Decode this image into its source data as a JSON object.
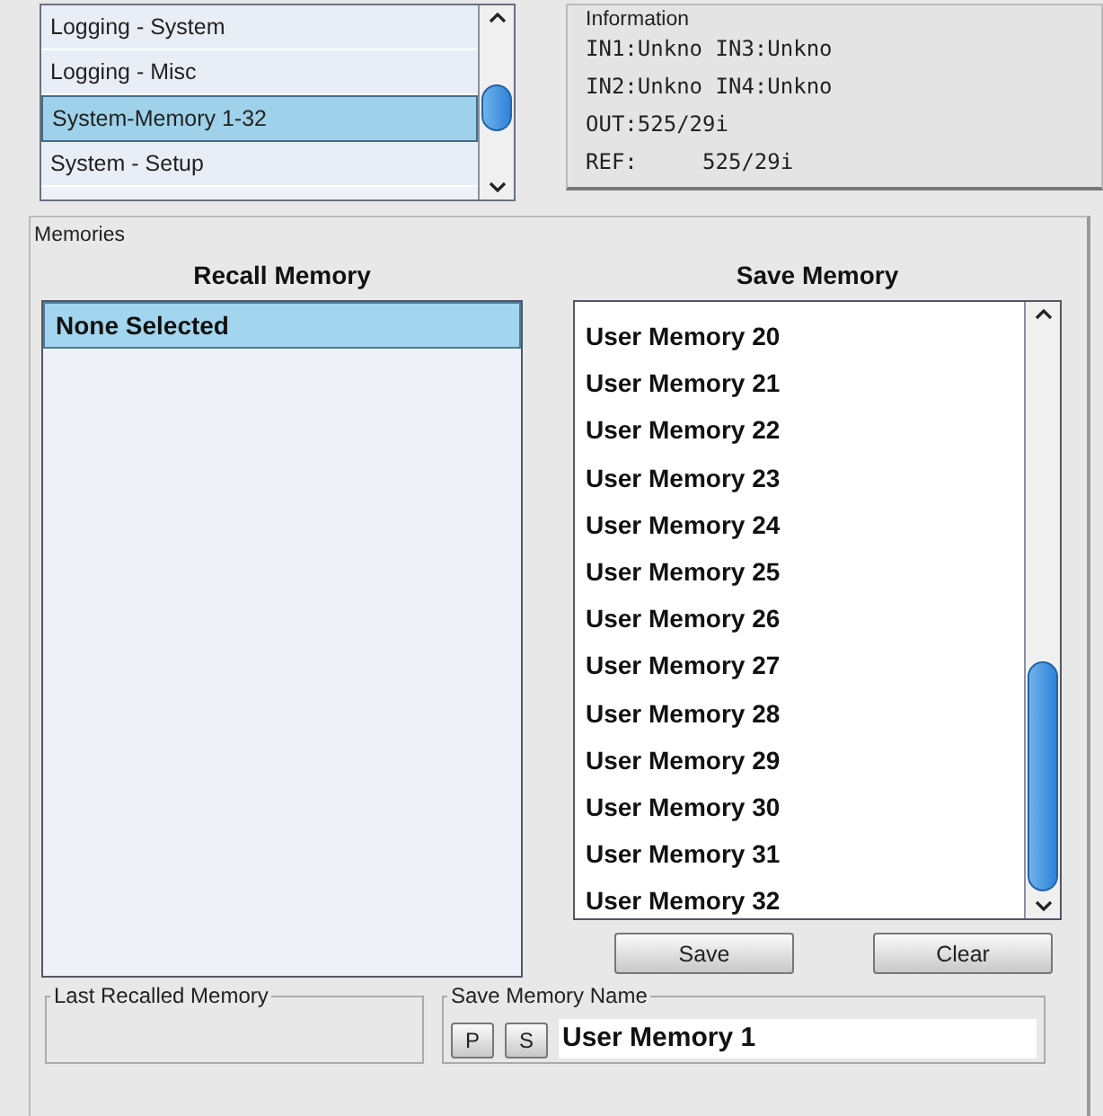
{
  "menu_list": {
    "items": [
      {
        "label": "Logging - System",
        "selected": false
      },
      {
        "label": "Logging - Misc",
        "selected": false
      },
      {
        "label": "System-Memory 1-32",
        "selected": true
      },
      {
        "label": "System - Setup",
        "selected": false
      }
    ]
  },
  "information": {
    "title": "Information",
    "lines": [
      "IN1:Unkno IN3:Unkno",
      "IN2:Unkno IN4:Unkno",
      "OUT:525/29i",
      "REF:     525/29i"
    ]
  },
  "memories": {
    "title": "Memories",
    "recall": {
      "title": "Recall Memory",
      "items": [
        {
          "label": "None Selected",
          "selected": true
        }
      ]
    },
    "save": {
      "title": "Save Memory",
      "items": [
        {
          "label": "User Memory 20",
          "selected": false
        },
        {
          "label": "User Memory 21",
          "selected": false
        },
        {
          "label": "User Memory 22",
          "selected": false
        },
        {
          "label": "User Memory 23",
          "selected": false
        },
        {
          "label": "User Memory 24",
          "selected": false
        },
        {
          "label": "User Memory 25",
          "selected": false
        },
        {
          "label": "User Memory 26",
          "selected": false
        },
        {
          "label": "User Memory 27",
          "selected": false
        },
        {
          "label": "User Memory 28",
          "selected": false
        },
        {
          "label": "User Memory 29",
          "selected": false
        },
        {
          "label": "User Memory 30",
          "selected": false
        },
        {
          "label": "User Memory 31",
          "selected": false
        },
        {
          "label": "User Memory 32",
          "selected": false
        }
      ],
      "buttons": [
        "Save",
        "Clear"
      ]
    },
    "last_recalled": {
      "title": "Last Recalled Memory"
    },
    "save_name": {
      "title": "Save Memory Name",
      "buttons": [
        "P",
        "S"
      ],
      "value": "User Memory 1"
    }
  }
}
